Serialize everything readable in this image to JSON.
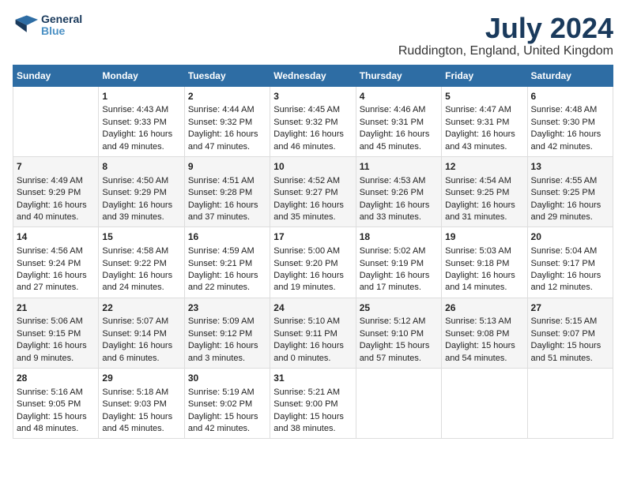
{
  "header": {
    "logo_line1": "General",
    "logo_line2": "Blue",
    "month_title": "July 2024",
    "location": "Ruddington, England, United Kingdom"
  },
  "days_of_week": [
    "Sunday",
    "Monday",
    "Tuesday",
    "Wednesday",
    "Thursday",
    "Friday",
    "Saturday"
  ],
  "weeks": [
    [
      {
        "day": "",
        "info": ""
      },
      {
        "day": "1",
        "info": "Sunrise: 4:43 AM\nSunset: 9:33 PM\nDaylight: 16 hours\nand 49 minutes."
      },
      {
        "day": "2",
        "info": "Sunrise: 4:44 AM\nSunset: 9:32 PM\nDaylight: 16 hours\nand 47 minutes."
      },
      {
        "day": "3",
        "info": "Sunrise: 4:45 AM\nSunset: 9:32 PM\nDaylight: 16 hours\nand 46 minutes."
      },
      {
        "day": "4",
        "info": "Sunrise: 4:46 AM\nSunset: 9:31 PM\nDaylight: 16 hours\nand 45 minutes."
      },
      {
        "day": "5",
        "info": "Sunrise: 4:47 AM\nSunset: 9:31 PM\nDaylight: 16 hours\nand 43 minutes."
      },
      {
        "day": "6",
        "info": "Sunrise: 4:48 AM\nSunset: 9:30 PM\nDaylight: 16 hours\nand 42 minutes."
      }
    ],
    [
      {
        "day": "7",
        "info": "Sunrise: 4:49 AM\nSunset: 9:29 PM\nDaylight: 16 hours\nand 40 minutes."
      },
      {
        "day": "8",
        "info": "Sunrise: 4:50 AM\nSunset: 9:29 PM\nDaylight: 16 hours\nand 39 minutes."
      },
      {
        "day": "9",
        "info": "Sunrise: 4:51 AM\nSunset: 9:28 PM\nDaylight: 16 hours\nand 37 minutes."
      },
      {
        "day": "10",
        "info": "Sunrise: 4:52 AM\nSunset: 9:27 PM\nDaylight: 16 hours\nand 35 minutes."
      },
      {
        "day": "11",
        "info": "Sunrise: 4:53 AM\nSunset: 9:26 PM\nDaylight: 16 hours\nand 33 minutes."
      },
      {
        "day": "12",
        "info": "Sunrise: 4:54 AM\nSunset: 9:25 PM\nDaylight: 16 hours\nand 31 minutes."
      },
      {
        "day": "13",
        "info": "Sunrise: 4:55 AM\nSunset: 9:25 PM\nDaylight: 16 hours\nand 29 minutes."
      }
    ],
    [
      {
        "day": "14",
        "info": "Sunrise: 4:56 AM\nSunset: 9:24 PM\nDaylight: 16 hours\nand 27 minutes."
      },
      {
        "day": "15",
        "info": "Sunrise: 4:58 AM\nSunset: 9:22 PM\nDaylight: 16 hours\nand 24 minutes."
      },
      {
        "day": "16",
        "info": "Sunrise: 4:59 AM\nSunset: 9:21 PM\nDaylight: 16 hours\nand 22 minutes."
      },
      {
        "day": "17",
        "info": "Sunrise: 5:00 AM\nSunset: 9:20 PM\nDaylight: 16 hours\nand 19 minutes."
      },
      {
        "day": "18",
        "info": "Sunrise: 5:02 AM\nSunset: 9:19 PM\nDaylight: 16 hours\nand 17 minutes."
      },
      {
        "day": "19",
        "info": "Sunrise: 5:03 AM\nSunset: 9:18 PM\nDaylight: 16 hours\nand 14 minutes."
      },
      {
        "day": "20",
        "info": "Sunrise: 5:04 AM\nSunset: 9:17 PM\nDaylight: 16 hours\nand 12 minutes."
      }
    ],
    [
      {
        "day": "21",
        "info": "Sunrise: 5:06 AM\nSunset: 9:15 PM\nDaylight: 16 hours\nand 9 minutes."
      },
      {
        "day": "22",
        "info": "Sunrise: 5:07 AM\nSunset: 9:14 PM\nDaylight: 16 hours\nand 6 minutes."
      },
      {
        "day": "23",
        "info": "Sunrise: 5:09 AM\nSunset: 9:12 PM\nDaylight: 16 hours\nand 3 minutes."
      },
      {
        "day": "24",
        "info": "Sunrise: 5:10 AM\nSunset: 9:11 PM\nDaylight: 16 hours\nand 0 minutes."
      },
      {
        "day": "25",
        "info": "Sunrise: 5:12 AM\nSunset: 9:10 PM\nDaylight: 15 hours\nand 57 minutes."
      },
      {
        "day": "26",
        "info": "Sunrise: 5:13 AM\nSunset: 9:08 PM\nDaylight: 15 hours\nand 54 minutes."
      },
      {
        "day": "27",
        "info": "Sunrise: 5:15 AM\nSunset: 9:07 PM\nDaylight: 15 hours\nand 51 minutes."
      }
    ],
    [
      {
        "day": "28",
        "info": "Sunrise: 5:16 AM\nSunset: 9:05 PM\nDaylight: 15 hours\nand 48 minutes."
      },
      {
        "day": "29",
        "info": "Sunrise: 5:18 AM\nSunset: 9:03 PM\nDaylight: 15 hours\nand 45 minutes."
      },
      {
        "day": "30",
        "info": "Sunrise: 5:19 AM\nSunset: 9:02 PM\nDaylight: 15 hours\nand 42 minutes."
      },
      {
        "day": "31",
        "info": "Sunrise: 5:21 AM\nSunset: 9:00 PM\nDaylight: 15 hours\nand 38 minutes."
      },
      {
        "day": "",
        "info": ""
      },
      {
        "day": "",
        "info": ""
      },
      {
        "day": "",
        "info": ""
      }
    ]
  ]
}
